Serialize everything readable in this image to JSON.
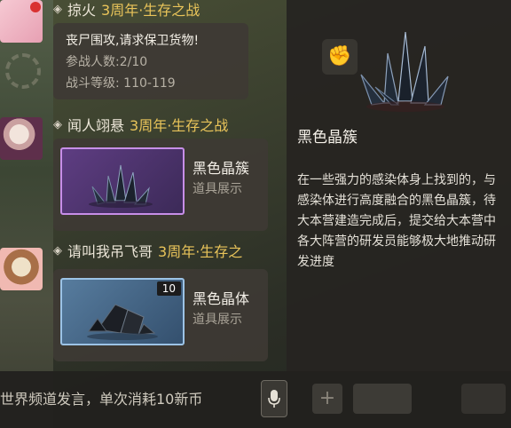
{
  "messages": [
    {
      "sender": "掠火",
      "event_tag": "3周年·生存之战",
      "lines": [
        "丧尸围攻,请求保卫货物!",
        "参战人数:2/10",
        "战斗等级: 110-119"
      ]
    },
    {
      "sender": "闻人翊悬",
      "event_tag": "3周年·生存之战",
      "item": {
        "name": "黑色晶簇",
        "subtitle": "道具展示",
        "rarity_color": "#c78ee8"
      }
    },
    {
      "sender": "请叫我吊飞哥",
      "event_tag": "3周年·生存之",
      "item": {
        "name": "黑色晶体",
        "subtitle": "道具展示",
        "quantity": "10",
        "rarity_color": "#9cc3e6"
      }
    }
  ],
  "detail": {
    "title": "黑色晶簇",
    "description": "在一些强力的感染体身上找到的，与感染体进行高度融合的黑色晶簇，待大本营建造完成后，提交给大本营中各大阵营的研发员能够极大地推动研发进度"
  },
  "chat_bar": {
    "placeholder": "世界频道发言，单次消耗10新币"
  },
  "icons": {
    "mic": "microphone-icon",
    "plus": "plus-icon"
  }
}
